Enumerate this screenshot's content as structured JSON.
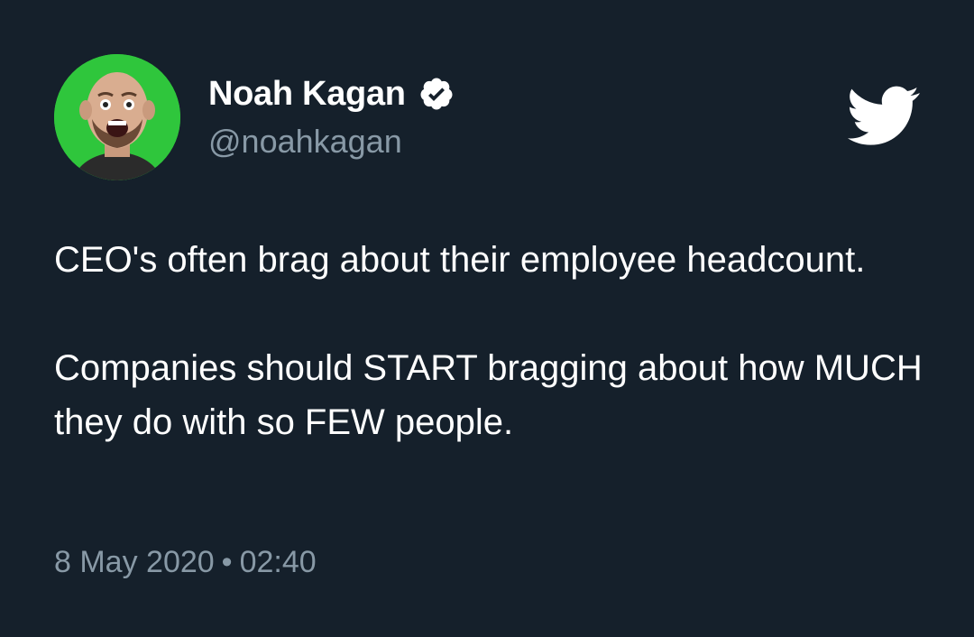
{
  "author": {
    "name": "Noah Kagan",
    "handle": "@noahkagan",
    "verified": true,
    "avatar_icon": "profile-photo"
  },
  "tweet": {
    "paragraphs": [
      "CEO's often brag about their employee headcount.",
      "Companies should START bragging about how MUCH they do with so FEW people."
    ],
    "date": "8 May 2020",
    "separator": "•",
    "time": "02:40"
  },
  "icons": {
    "brand": "twitter-bird-icon",
    "verified": "verified-badge-icon"
  },
  "colors": {
    "background": "#15202b",
    "primary_text": "#ffffff",
    "secondary_text": "#8899a6",
    "avatar_background": "#2fc63c"
  }
}
